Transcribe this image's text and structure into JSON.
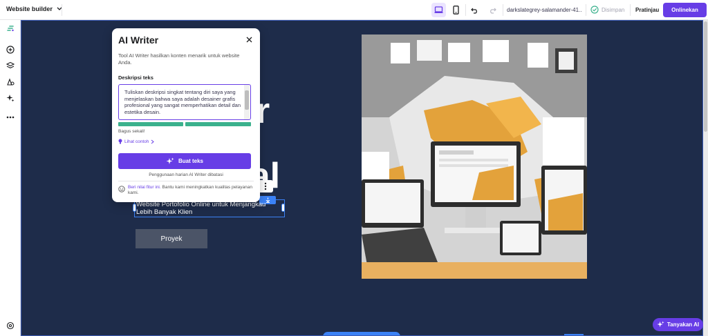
{
  "topbar": {
    "site_menu_label": "Website builder",
    "domain": "darkslategrey-salamander-41...",
    "saved_label": "Disimpan",
    "preview_label": "Pratinjau",
    "publish_label": "Onlinekan"
  },
  "canvas": {
    "hero_partial_1": "r",
    "hero_partial_2": "nal",
    "subtitle": "Website Portofolio Online untuk Menjangkau Lebih Banyak Klien",
    "cta_label": "Proyek"
  },
  "modal": {
    "title": "AI Writer",
    "description": "Tool AI Writer hasilkan konten menarik untuk website Anda.",
    "field_label": "Deskripsi teks",
    "field_value": "Tuliskan deskripsi singkat tentang diri saya yang menjelaskan bahwa saya adalah desainer grafis profesional yang sangat memperhatikan detail dan estetika desain.",
    "quality_label": "Bagus sekali!",
    "quality_level": 1.0,
    "example_link": "Lihat contoh",
    "generate_label": "Buat teks",
    "limit_note": "Penggunaan harian AI Writer dibatasi",
    "feedback_link": "Beri nilai fitur ini.",
    "feedback_text": "Bantu kami meningkatkan kualitas pelayanan kami."
  },
  "ask_ai_label": "Tanyakan AI",
  "colors": {
    "brand": "#673de6",
    "canvas_bg": "#1e2c4a",
    "selection": "#3b82f6",
    "meter": "#3bb18d"
  }
}
